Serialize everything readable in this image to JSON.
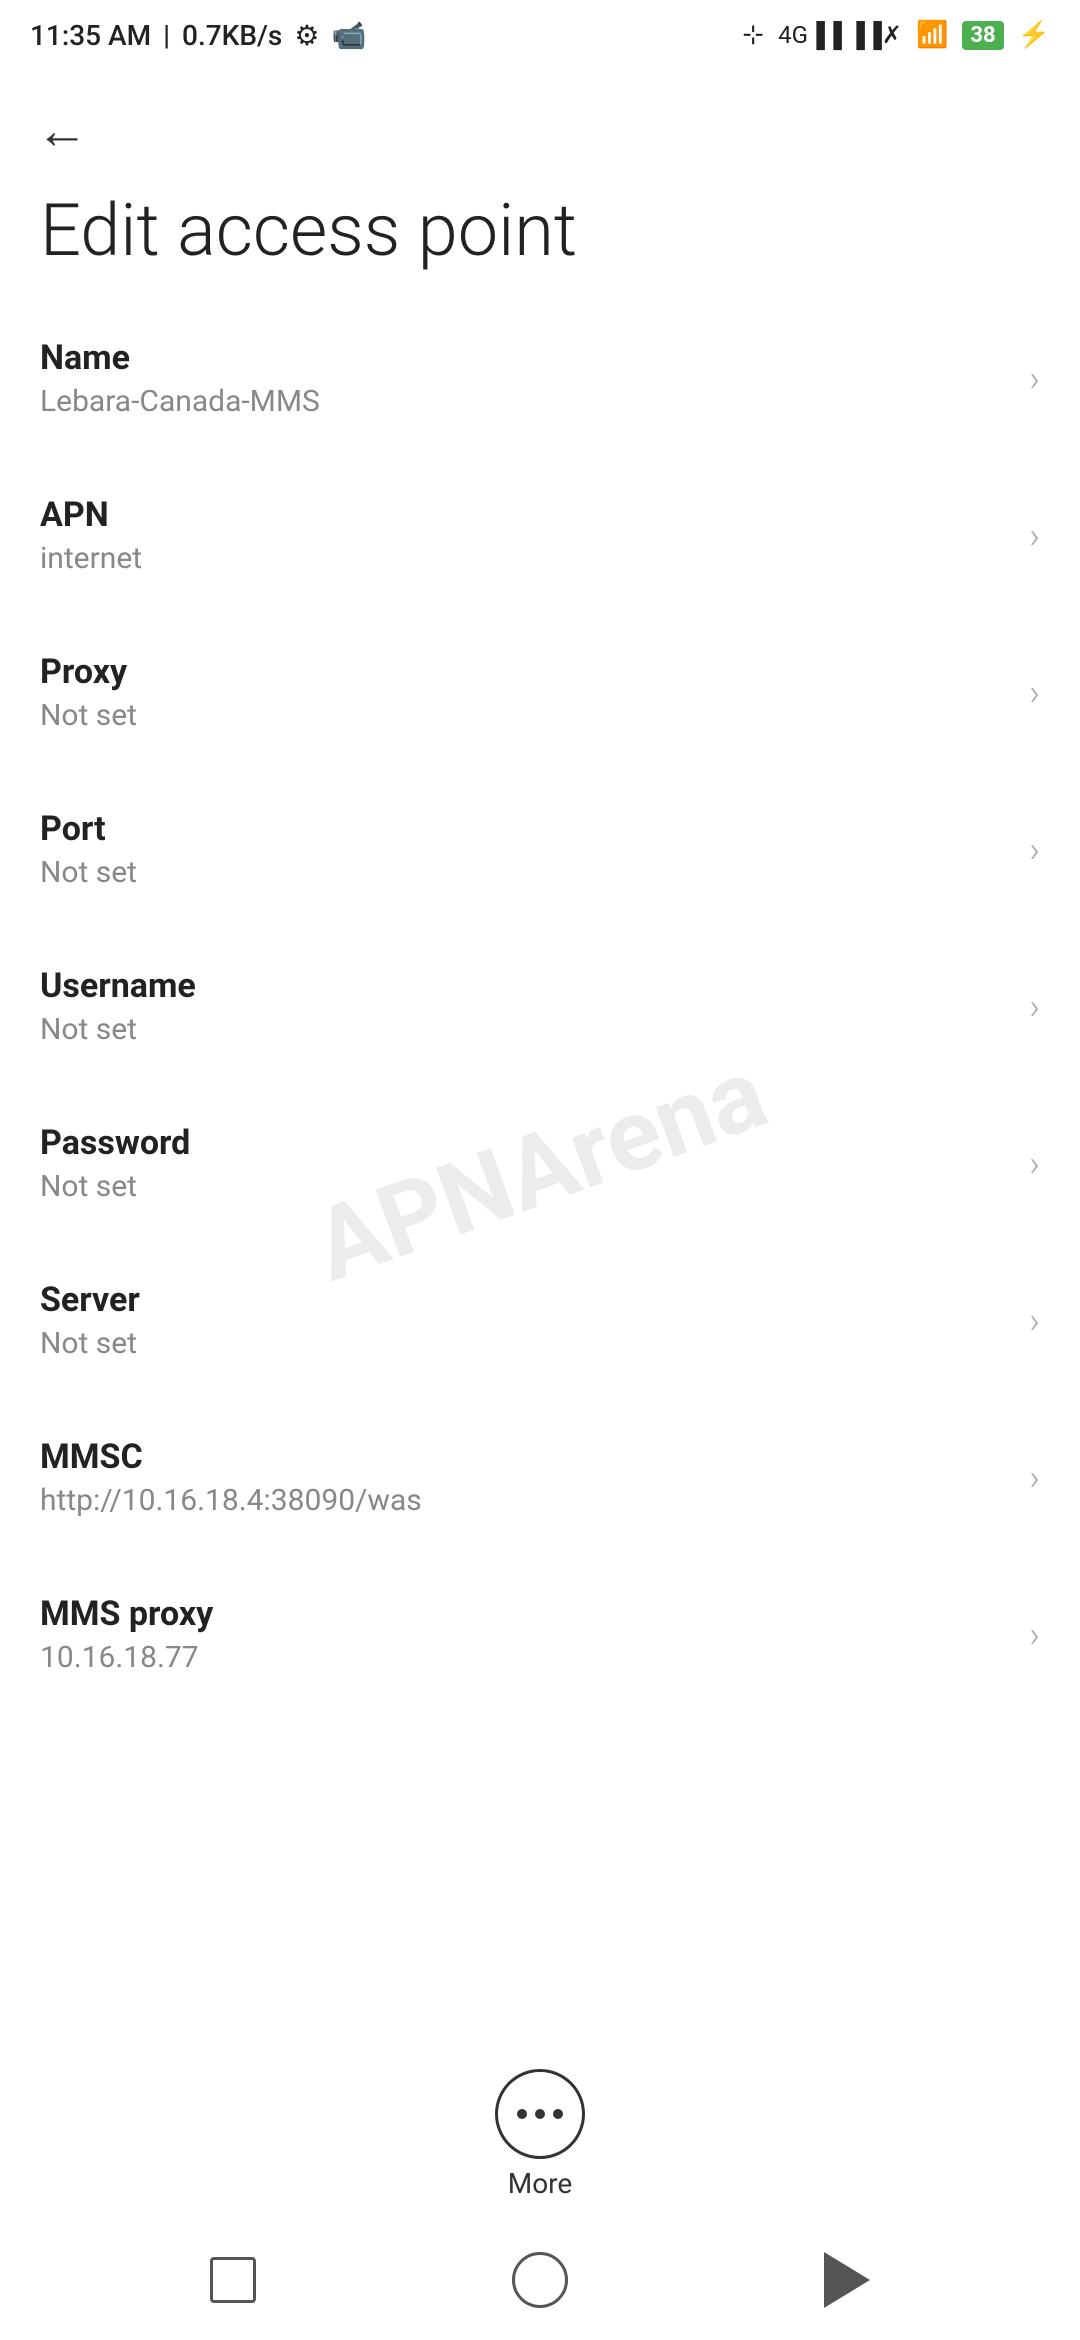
{
  "statusBar": {
    "time": "11:35 AM",
    "speed": "0.7KB/s",
    "battery": "38"
  },
  "header": {
    "backLabel": "←"
  },
  "pageTitle": "Edit access point",
  "settings": [
    {
      "label": "Name",
      "value": "Lebara-Canada-MMS"
    },
    {
      "label": "APN",
      "value": "internet"
    },
    {
      "label": "Proxy",
      "value": "Not set"
    },
    {
      "label": "Port",
      "value": "Not set"
    },
    {
      "label": "Username",
      "value": "Not set"
    },
    {
      "label": "Password",
      "value": "Not set"
    },
    {
      "label": "Server",
      "value": "Not set"
    },
    {
      "label": "MMSC",
      "value": "http://10.16.18.4:38090/was"
    },
    {
      "label": "MMS proxy",
      "value": "10.16.18.77"
    }
  ],
  "moreButton": {
    "label": "More"
  },
  "watermark": "APNArena"
}
